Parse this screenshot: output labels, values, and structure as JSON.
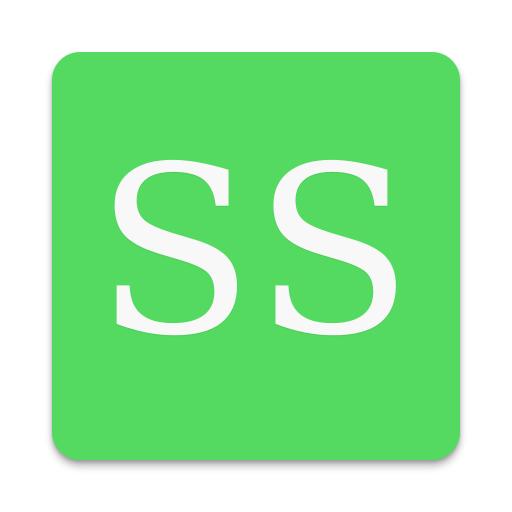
{
  "app_icon": {
    "text": "SS",
    "background_color": "#55da61",
    "text_color": "#f8f8f8"
  }
}
